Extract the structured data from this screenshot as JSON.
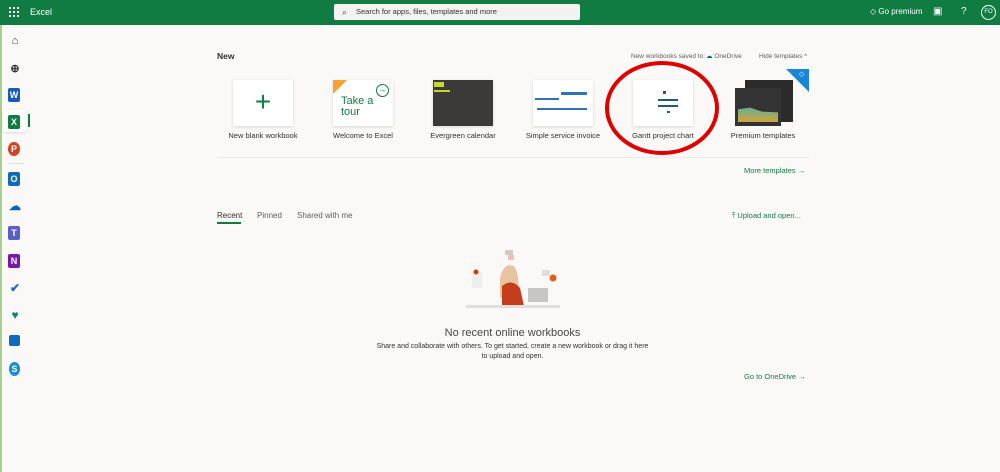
{
  "header": {
    "app_name": "Excel",
    "search_placeholder": "Search for apps, files, templates and more",
    "go_premium": "Go premium",
    "help": "?",
    "avatar_initials": "FO",
    "brand_color": "#107c41"
  },
  "rail": {
    "items": [
      "home",
      "create",
      "word",
      "excel",
      "powerpoint",
      "outlook",
      "onedrive",
      "teams",
      "onenote",
      "todo",
      "family-safety",
      "calendar",
      "skype"
    ],
    "selected": "excel"
  },
  "new_section": {
    "title": "New",
    "saved_to_label": "New workbooks saved to:",
    "saved_to_location": "OneDrive",
    "hide_templates": "Hide templates",
    "templates": [
      {
        "label": "New blank workbook"
      },
      {
        "label": "Welcome to Excel",
        "thumb_text": "Take a tour",
        "badge": "New"
      },
      {
        "label": "Evergreen calendar"
      },
      {
        "label": "Simple service invoice"
      },
      {
        "label": "Gantt project chart",
        "highlighted": true
      },
      {
        "label": "Premium templates"
      }
    ],
    "more_templates": "More templates"
  },
  "files": {
    "tabs": [
      "Recent",
      "Pinned",
      "Shared with me"
    ],
    "active_tab": "Recent",
    "upload": "Upload and open...",
    "empty_title": "No recent online workbooks",
    "empty_line1": "Share and collaborate with others. To get started, create a new workbook or drag it here",
    "empty_line2": "to upload and open.",
    "go_onedrive": "Go to OneDrive"
  },
  "annotation": {
    "color": "#e00000"
  }
}
